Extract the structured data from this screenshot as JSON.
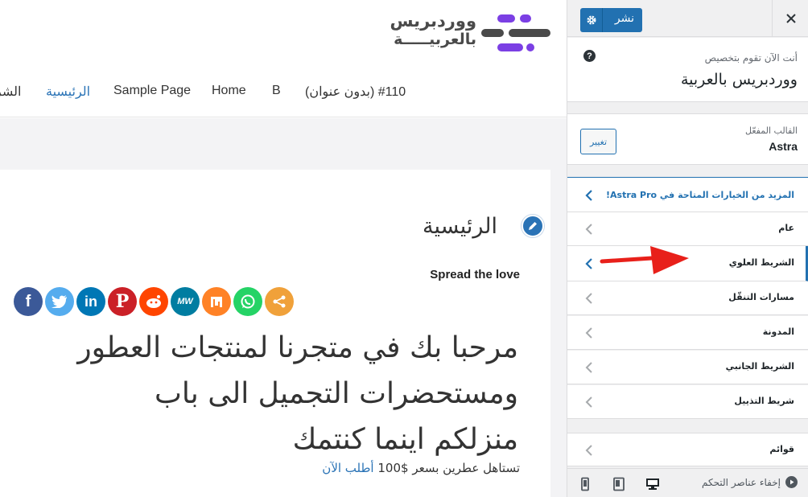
{
  "preview": {
    "logo": {
      "line1": "ووردبريس",
      "line2": "بالعربيـــــة",
      "mark_color_primary": "#7b3fe4",
      "mark_color_secondary": "#4a4a4a"
    },
    "nav": {
      "items": [
        "الشر",
        "الرئيسية",
        "Sample Page",
        "Home",
        "B",
        "#110 (بدون عنوان)"
      ],
      "active_color": "#2a73b6"
    },
    "page_heading": "الرئيسية",
    "spread_the_love": "Spread the love",
    "share_buttons": [
      {
        "icon": "facebook-icon",
        "glyph": "f",
        "color": "#3b5998"
      },
      {
        "icon": "twitter-icon",
        "glyph": "t",
        "color": "#55acee"
      },
      {
        "icon": "linkedin-icon",
        "glyph": "in",
        "color": "#0077b5"
      },
      {
        "icon": "pinterest-icon",
        "glyph": "P",
        "color": "#cb2027"
      },
      {
        "icon": "reddit-icon",
        "glyph": "r",
        "color": "#ff4500"
      },
      {
        "icon": "mewe-icon",
        "glyph": "MW",
        "color": "#007da1"
      },
      {
        "icon": "mix-icon",
        "glyph": "m",
        "color": "#ff8226"
      },
      {
        "icon": "whatsapp-icon",
        "glyph": "w",
        "color": "#25d366"
      },
      {
        "icon": "share-icon",
        "glyph": "<",
        "color": "#f0a13a"
      }
    ],
    "hero": {
      "line1": "مرحبا بك في متجرنا لمنتجات العطور",
      "line2": "ومستحضرات التجميل الى باب",
      "line3": "منزلكم اينما كنتمك"
    },
    "hero_sub": {
      "text": "تستاهل عطرين بسعر $100",
      "link": "أطلب الآن"
    }
  },
  "sidebar": {
    "publish_label": "نشر",
    "customizing_label": "أنت الآن تقوم بتخصيص",
    "site_title": "ووردبريس بالعربية",
    "theme_label": "القالب المفعّل",
    "theme_name": "Astra",
    "change_label": "تغيير",
    "panels": [
      {
        "label": "المزيد من الخيارات المتاحة في Astra Pro!",
        "kind": "astra"
      },
      {
        "label": "عام",
        "kind": "normal"
      },
      {
        "label": "الشريط العلوي",
        "kind": "highlight"
      },
      {
        "label": "مسارات التنقّل",
        "kind": "normal"
      },
      {
        "label": "المدونة",
        "kind": "normal"
      },
      {
        "label": "الشريط الجانبي",
        "kind": "normal"
      },
      {
        "label": "شريط التذييل",
        "kind": "normal"
      },
      {
        "label": "قوائم",
        "kind": "normal"
      }
    ],
    "hide_controls": "إخفاء عناصر التحكم",
    "accent_color": "#2271b1",
    "annotation_arrow_color": "#e8201a"
  }
}
